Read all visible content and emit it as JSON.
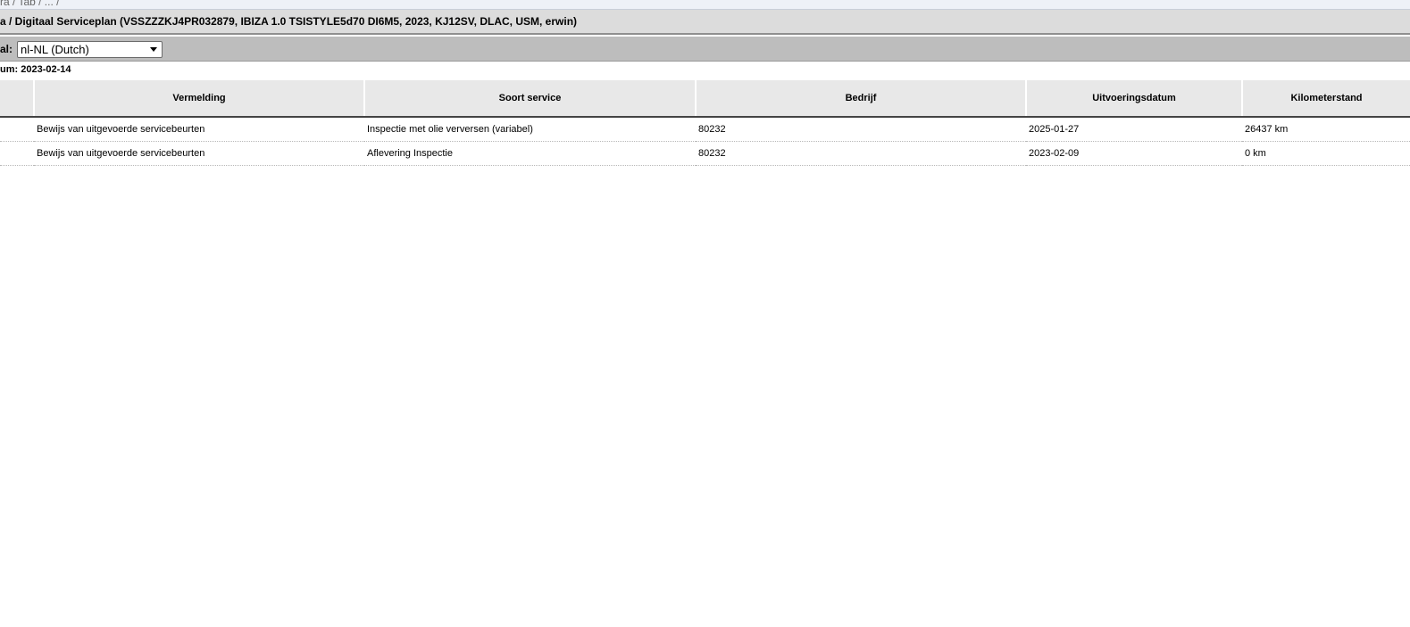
{
  "breadcrumb_fragment": "ra / Tab / ... /",
  "header": {
    "title": "a / Digitaal Serviceplan (VSSZZZKJ4PR032879, IBIZA 1.0 TSISTYLE5d70 DI6M5, 2023, KJ12SV, DLAC, USM, erwin)"
  },
  "language": {
    "label": "al:",
    "selected": "nl-NL (Dutch)"
  },
  "datum_line": "um: 2023-02-14",
  "table": {
    "columns": [
      "",
      "Vermelding",
      "Soort service",
      "Bedrijf",
      "Uitvoeringsdatum",
      "Kilometerstand"
    ],
    "rows": [
      {
        "cell0": "",
        "vermelding": "Bewijs van uitgevoerde servicebeurten",
        "soort": "Inspectie met olie verversen (variabel)",
        "bedrijf": "80232",
        "datum": "2025-01-27",
        "km": "26437 km"
      },
      {
        "cell0": "",
        "vermelding": "Bewijs van uitgevoerde servicebeurten",
        "soort": "Aflevering Inspectie",
        "bedrijf": "80232",
        "datum": "2023-02-09",
        "km": "0 km"
      }
    ]
  },
  "colors": {
    "title_bg": "#dcdcdc",
    "lang_bg": "#bdbdbd",
    "header_bg": "#e8e8e8"
  }
}
